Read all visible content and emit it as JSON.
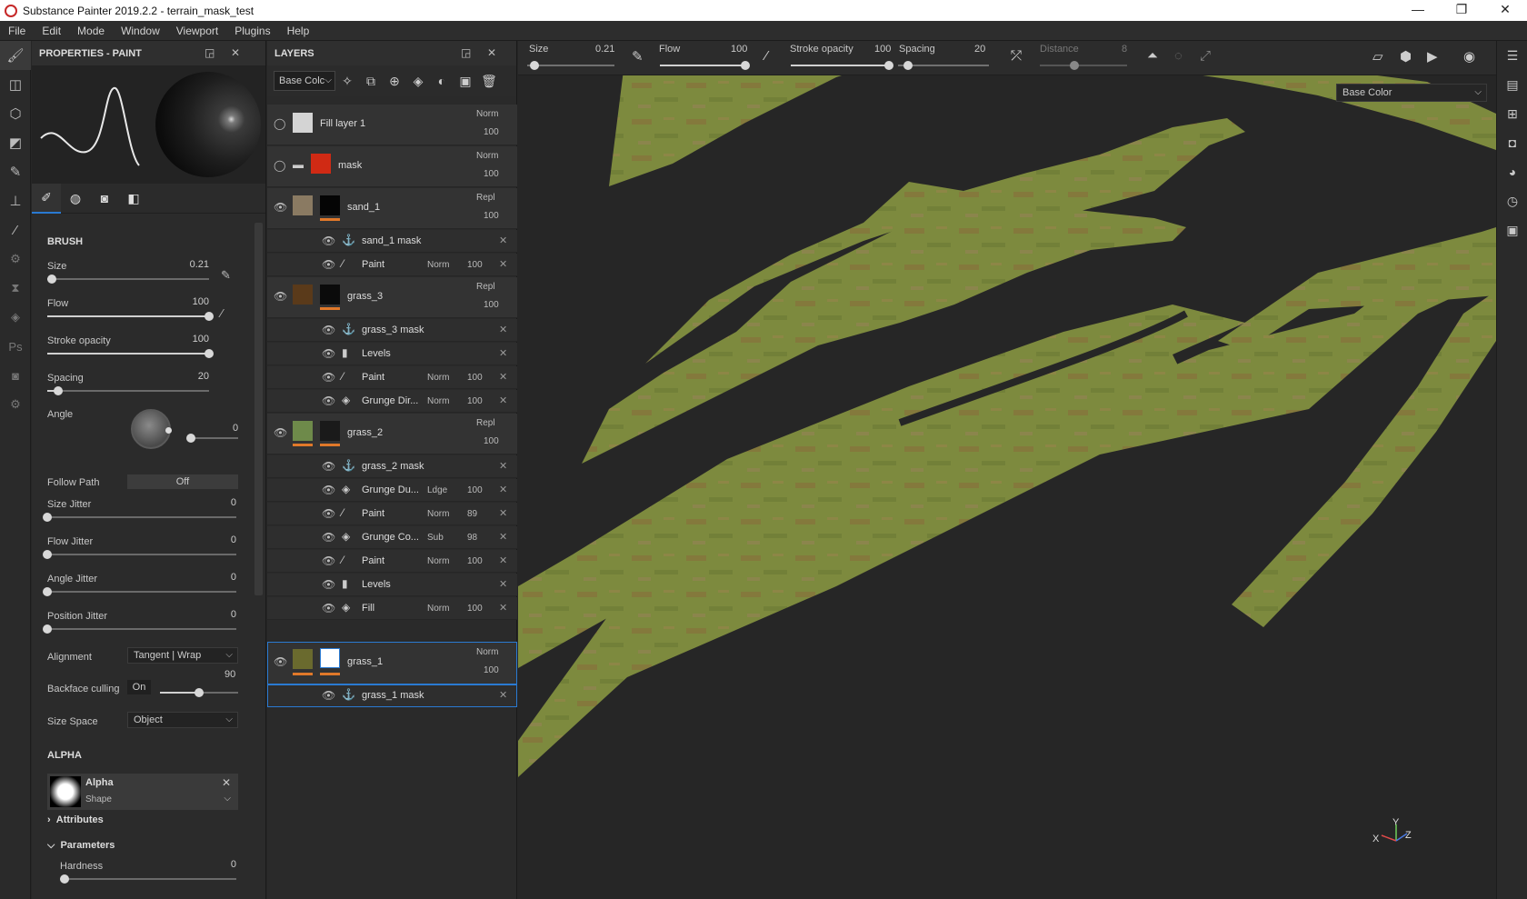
{
  "window": {
    "title": "Substance Painter 2019.2.2 - terrain_mask_test",
    "minimize": "—",
    "maximize": "❐",
    "close": "✕"
  },
  "menu": [
    "File",
    "Edit",
    "Mode",
    "Window",
    "Viewport",
    "Plugins",
    "Help"
  ],
  "properties": {
    "title": "PROPERTIES - PAINT",
    "brush_header": "BRUSH",
    "size": {
      "label": "Size",
      "value": "0.21",
      "level": 0.03
    },
    "flow": {
      "label": "Flow",
      "value": "100",
      "level": 1.0
    },
    "stroke_opacity": {
      "label": "Stroke opacity",
      "value": "100",
      "level": 1.0
    },
    "spacing": {
      "label": "Spacing",
      "value": "20",
      "level": 0.07
    },
    "angle": {
      "label": "Angle",
      "value": "0"
    },
    "follow_path": {
      "label": "Follow Path",
      "value": "Off"
    },
    "size_jitter": {
      "label": "Size Jitter",
      "value": "0"
    },
    "flow_jitter": {
      "label": "Flow Jitter",
      "value": "0"
    },
    "angle_jitter": {
      "label": "Angle Jitter",
      "value": "0"
    },
    "position_jitter": {
      "label": "Position Jitter",
      "value": "0"
    },
    "alignment": {
      "label": "Alignment",
      "value": "Tangent | Wrap"
    },
    "backface": {
      "label": "Backface culling",
      "toggle": "On",
      "value": "90",
      "level": 0.5
    },
    "size_space": {
      "label": "Size Space",
      "value": "Object"
    },
    "alpha_header": "ALPHA",
    "alpha": {
      "name": "Alpha",
      "type": "Shape"
    },
    "attributes": "Attributes",
    "parameters": "Parameters",
    "hardness": {
      "label": "Hardness",
      "value": "0"
    }
  },
  "layers": {
    "title": "LAYERS",
    "channel_select": "Base Colc",
    "rows": [
      {
        "name": "Fill layer 1",
        "blend": "Norm",
        "opacity": "100"
      },
      {
        "name": "mask",
        "blend": "Norm",
        "opacity": "100"
      },
      {
        "name": "sand_1",
        "blend": "Repl",
        "opacity": "100"
      },
      {
        "name": "sand_1 mask"
      },
      {
        "name": "Paint",
        "blend": "Norm",
        "opacity": "100"
      },
      {
        "name": "grass_3",
        "blend": "Repl",
        "opacity": "100"
      },
      {
        "name": "grass_3 mask"
      },
      {
        "name": "Levels"
      },
      {
        "name": "Paint",
        "blend": "Norm",
        "opacity": "100"
      },
      {
        "name": "Grunge Dir...",
        "blend": "Norm",
        "opacity": "100"
      },
      {
        "name": "grass_2",
        "blend": "Repl",
        "opacity": "100"
      },
      {
        "name": "grass_2 mask"
      },
      {
        "name": "Grunge Du...",
        "blend": "Ldge",
        "opacity": "100"
      },
      {
        "name": "Paint",
        "blend": "Norm",
        "opacity": "89"
      },
      {
        "name": "Grunge Co...",
        "blend": "Sub",
        "opacity": "98"
      },
      {
        "name": "Paint",
        "blend": "Norm",
        "opacity": "100"
      },
      {
        "name": "Levels"
      },
      {
        "name": "Fill",
        "blend": "Norm",
        "opacity": "100"
      },
      {
        "name": "grass_1",
        "blend": "Norm",
        "opacity": "100"
      },
      {
        "name": "grass_1 mask"
      }
    ]
  },
  "viewport_toolbar": {
    "size": {
      "label": "Size",
      "value": "0.21"
    },
    "flow": {
      "label": "Flow",
      "value": "100"
    },
    "stroke_opacity": {
      "label": "Stroke opacity",
      "value": "100"
    },
    "spacing": {
      "label": "Spacing",
      "value": "20"
    },
    "distance": {
      "label": "Distance",
      "value": "8"
    }
  },
  "viewport": {
    "channel": "Base Color",
    "gizmo": {
      "x": "X",
      "y": "Y",
      "z": "Z"
    }
  },
  "colors": {
    "accent": "#2a7ad2",
    "terrain": "#7f8a3c",
    "background": "#262626",
    "orange_tag": "#e0782a"
  }
}
